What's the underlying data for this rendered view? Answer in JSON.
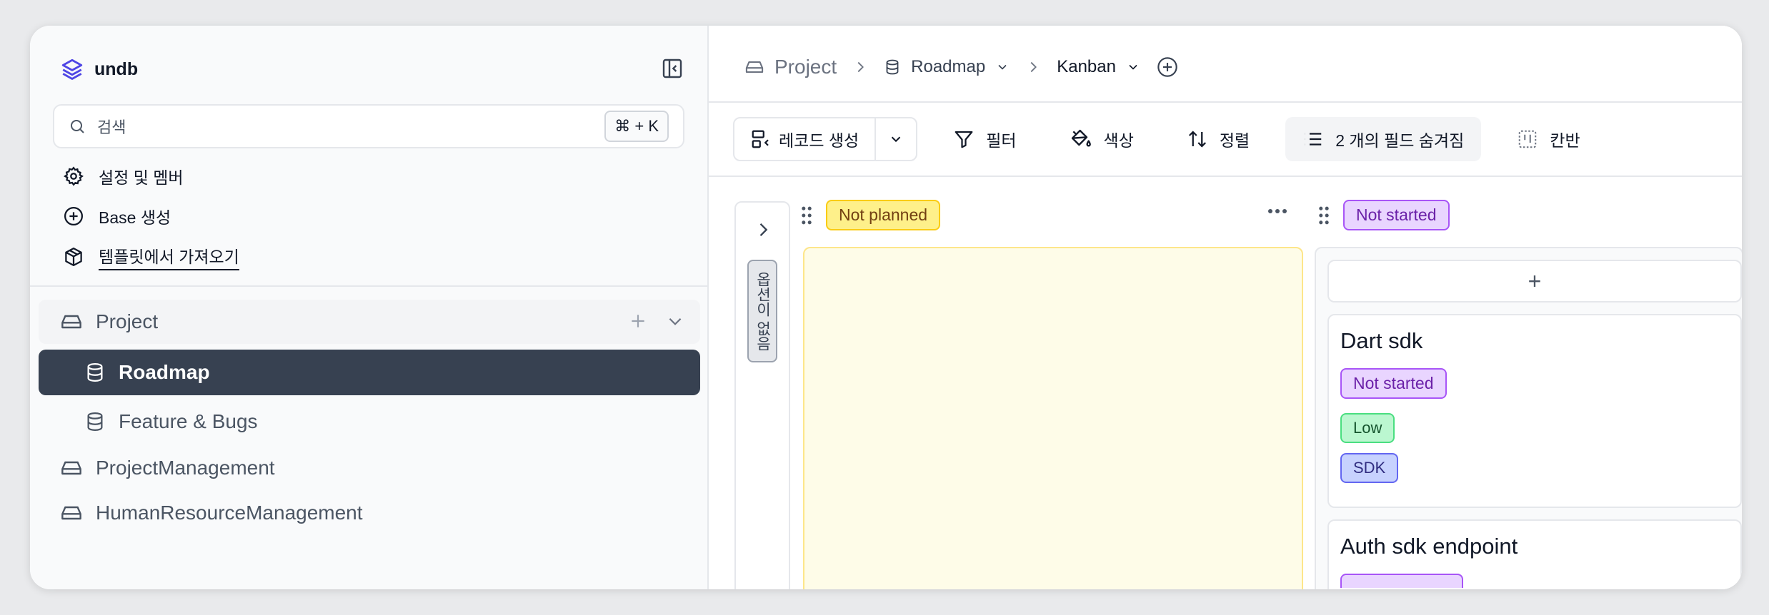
{
  "app": {
    "name": "undb",
    "brand_color": "#4f46e5"
  },
  "sidebar": {
    "search_placeholder": "검색",
    "shortcut": "⌘ + K",
    "menu": [
      {
        "label": "설정 및 멤버",
        "icon": "gear-icon"
      },
      {
        "label": "Base 생성",
        "icon": "plus-circle-icon"
      },
      {
        "label": "템플릿에서 가져오기",
        "icon": "package-icon"
      }
    ],
    "tree": {
      "project": "Project",
      "roadmap": "Roadmap",
      "feature_bugs": "Feature & Bugs",
      "project_management": "ProjectManagement",
      "hr_management": "HumanResourceManagement"
    }
  },
  "breadcrumb": {
    "project": "Project",
    "table": "Roadmap",
    "view": "Kanban"
  },
  "toolbar": {
    "create_record": "레코드 생성",
    "filter": "필터",
    "color": "색상",
    "sort": "정렬",
    "hidden_fields": "2 개의 필드 숨겨짐",
    "view_type": "칸반"
  },
  "kanban": {
    "collapsed_column_label": "옵션이 없음",
    "columns": [
      {
        "label": "Not planned",
        "color": "#fef08a"
      },
      {
        "label": "Not started",
        "color": "#e9d5ff"
      }
    ],
    "add_symbol": "+",
    "cards": [
      {
        "title": "Dart sdk",
        "status": "Not started",
        "priority": "Low",
        "tag": "SDK"
      },
      {
        "title": "Auth sdk endpoint"
      }
    ]
  }
}
